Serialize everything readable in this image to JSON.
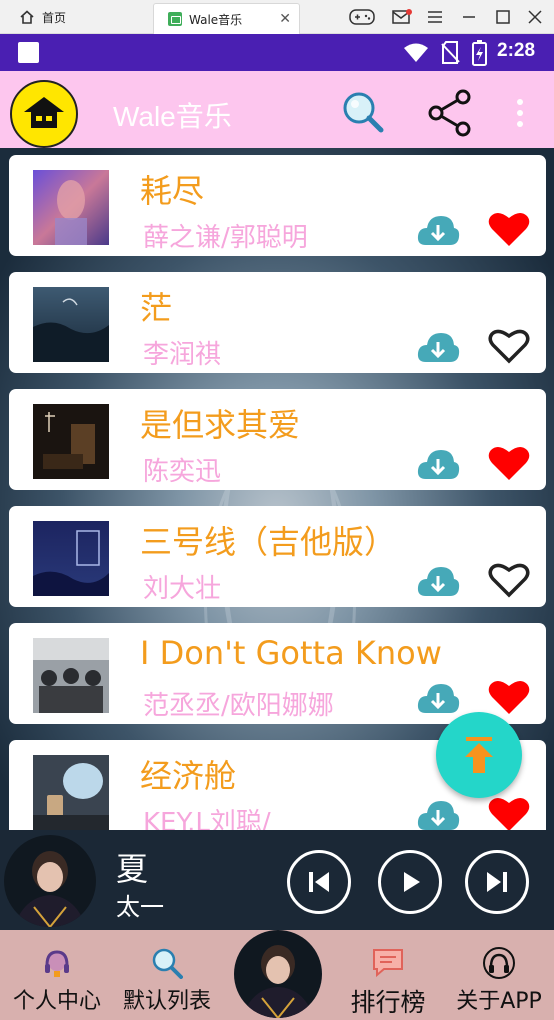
{
  "emulator": {
    "home_label": "首页",
    "tab_label": "Wale音乐",
    "tab_close": "✕"
  },
  "status_bar": {
    "time": "2:28"
  },
  "app_bar": {
    "title": "Wale音乐",
    "icons": {
      "home": "home-icon",
      "search": "search-icon",
      "share": "share-icon",
      "more": "more-vertical-icon"
    }
  },
  "songs": [
    {
      "title": "耗尽",
      "artist": "薛之谦/郭聪明",
      "liked": true
    },
    {
      "title": "茫",
      "artist": "李润祺",
      "liked": false
    },
    {
      "title": "是但求其爱",
      "artist": "陈奕迅",
      "liked": true
    },
    {
      "title": "三号线（吉他版）",
      "artist": "刘大壮",
      "liked": false
    },
    {
      "title": "I Don't Gotta Know",
      "artist": "范丞丞/欧阳娜娜",
      "liked": true
    },
    {
      "title": "经济舱",
      "artist": "KEY.L刘聪/",
      "liked": true
    }
  ],
  "player": {
    "title": "夏",
    "artist": "太一"
  },
  "bottom_nav": {
    "items": [
      {
        "label": "个人中心",
        "icon": "headphones-person-icon"
      },
      {
        "label": "默认列表",
        "icon": "search-icon"
      },
      {
        "label": "排行榜",
        "icon": "message-icon"
      },
      {
        "label": "关于APP",
        "icon": "headphones-icon"
      }
    ]
  },
  "colors": {
    "app_bar": "#fdc6ee",
    "status_bar": "#4a1fb2",
    "title_orange": "#f39c1d",
    "artist_pink": "#f6a6dc",
    "heart_red": "#ff0000",
    "download_teal": "#46a9b8",
    "fab_teal": "#24d6c9",
    "bottom_nav": "#d8b0ae"
  }
}
